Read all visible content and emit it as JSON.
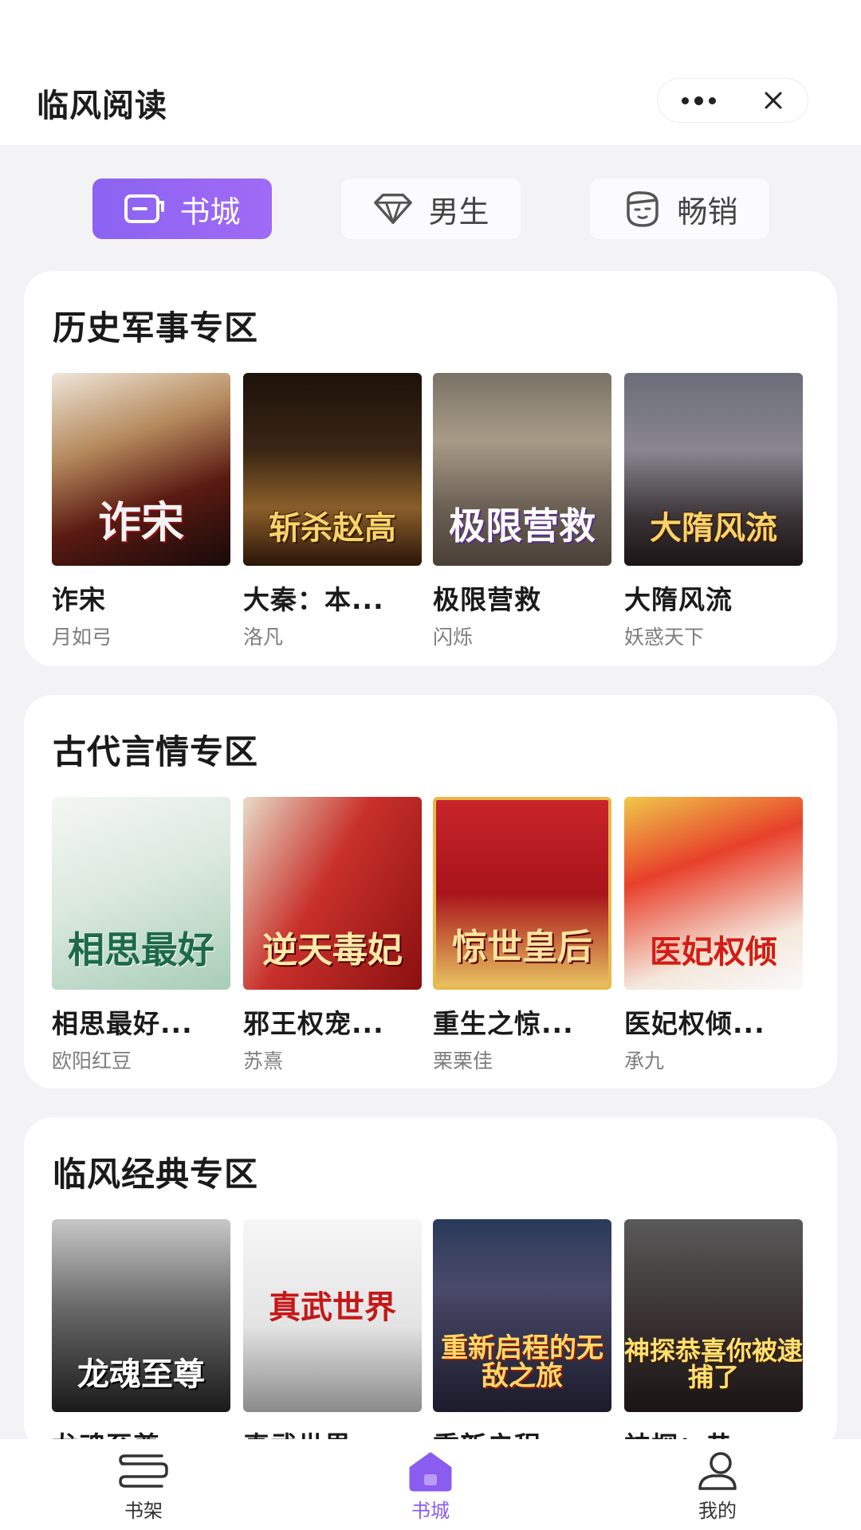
{
  "app": {
    "title": "临风阅读"
  },
  "tabs": [
    {
      "label": "书城",
      "icon": "bookstore-icon",
      "active": true
    },
    {
      "label": "男生",
      "icon": "diamond-icon",
      "active": false
    },
    {
      "label": "畅销",
      "icon": "face-icon",
      "active": false
    }
  ],
  "sections": [
    {
      "title": "历史军事专区",
      "books": [
        {
          "title": "诈宋",
          "author": "月如弓",
          "cover_text": "诈宋"
        },
        {
          "title": "大秦：本...",
          "author": "洛凡",
          "cover_text": "斩杀赵高"
        },
        {
          "title": "极限营救",
          "author": "闪烁",
          "cover_text": "极限营救"
        },
        {
          "title": "大隋风流",
          "author": "妖惑天下",
          "cover_text": "大隋风流"
        }
      ]
    },
    {
      "title": "古代言情专区",
      "books": [
        {
          "title": "相思最好...",
          "author": "欧阳红豆",
          "cover_text": "相思最好"
        },
        {
          "title": "邪王权宠...",
          "author": "苏熹",
          "cover_text": "逆天毒妃"
        },
        {
          "title": "重生之惊...",
          "author": "栗栗佳",
          "cover_text": "惊世皇后"
        },
        {
          "title": "医妃权倾...",
          "author": "承九",
          "cover_text": "医妃权倾"
        }
      ]
    },
    {
      "title": "临风经典专区",
      "books": [
        {
          "title": "龙魂至尊",
          "author": "",
          "cover_text": "龙魂至尊"
        },
        {
          "title": "真武世界",
          "author": "",
          "cover_text": "真武世界"
        },
        {
          "title": "重新启程",
          "author": "",
          "cover_text": "重新启程的无敌之旅"
        },
        {
          "title": "神探：恭",
          "author": "",
          "cover_text": "神探恭喜你被逮捕了"
        }
      ]
    }
  ],
  "nav": [
    {
      "label": "书架",
      "icon": "bookshelf-icon"
    },
    {
      "label": "书城",
      "icon": "bookstore-home-icon",
      "active": true
    },
    {
      "label": "我的",
      "icon": "profile-icon"
    }
  ],
  "colors": {
    "accent": "#8b63f2",
    "background": "#f3f3f6"
  }
}
